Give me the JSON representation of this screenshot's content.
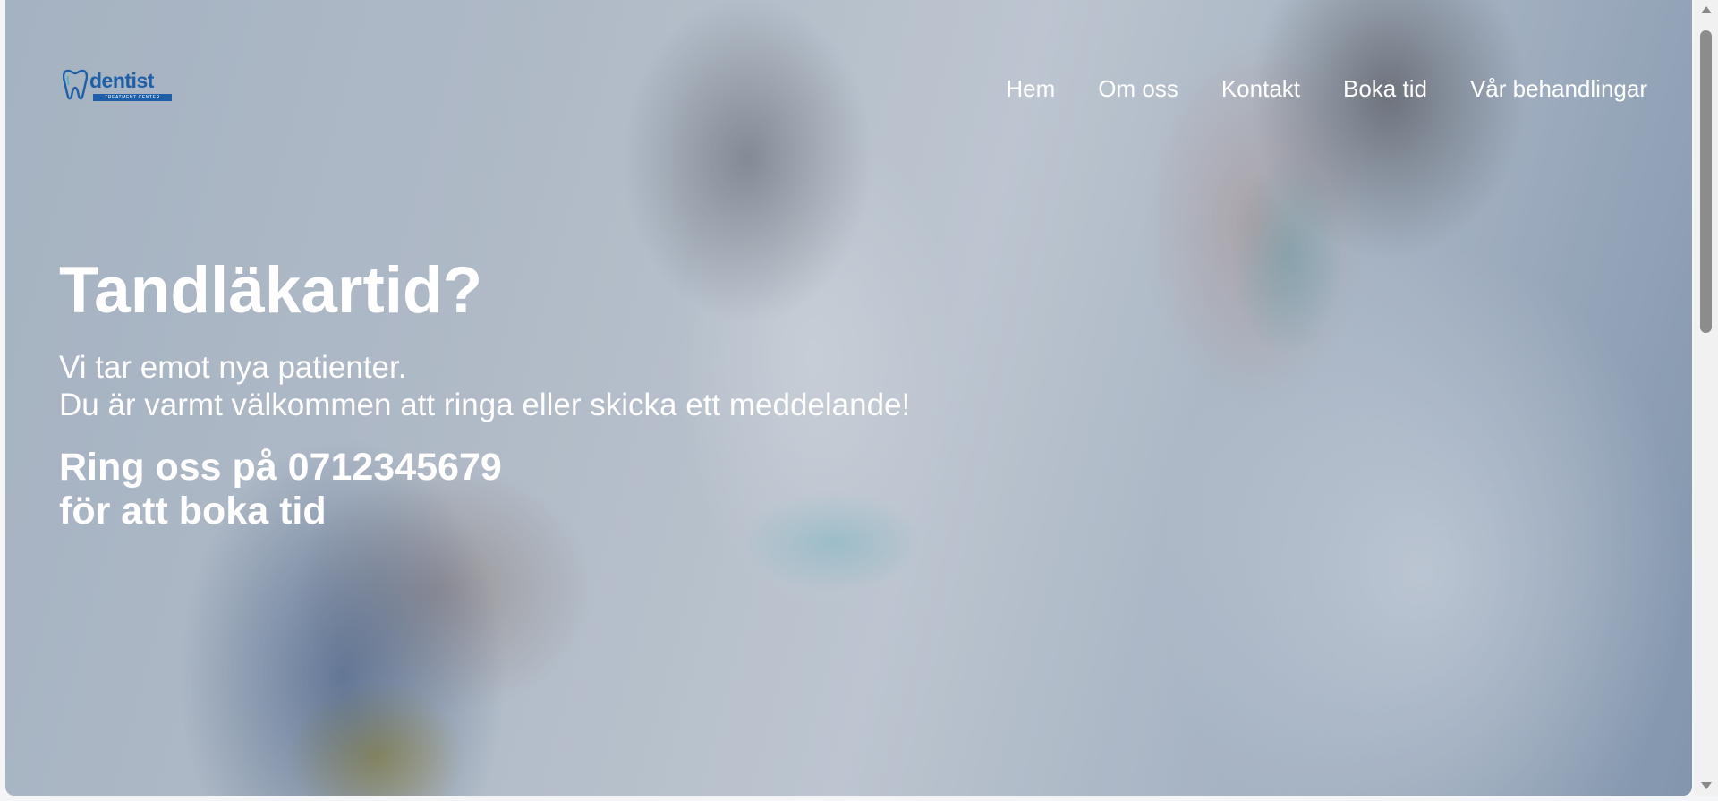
{
  "brand": {
    "logo_text": "dentist",
    "logo_subtext": "TREATMENT CENTER"
  },
  "nav": {
    "items": [
      {
        "label": "Hem"
      },
      {
        "label": "Om oss"
      },
      {
        "label": "Kontakt"
      },
      {
        "label": "Boka tid"
      },
      {
        "label": "Vår behandlingar"
      }
    ]
  },
  "hero": {
    "title": "Tandläkartid?",
    "text_line1": "Vi tar emot nya patienter.",
    "text_line2": "Du är varmt välkommen att ringa eller skicka ett meddelande!",
    "call_line1": "Ring oss på 0712345679",
    "call_line2": "för att boka tid"
  },
  "colors": {
    "brand_blue": "#1f5fa8",
    "text": "#ffffff"
  }
}
